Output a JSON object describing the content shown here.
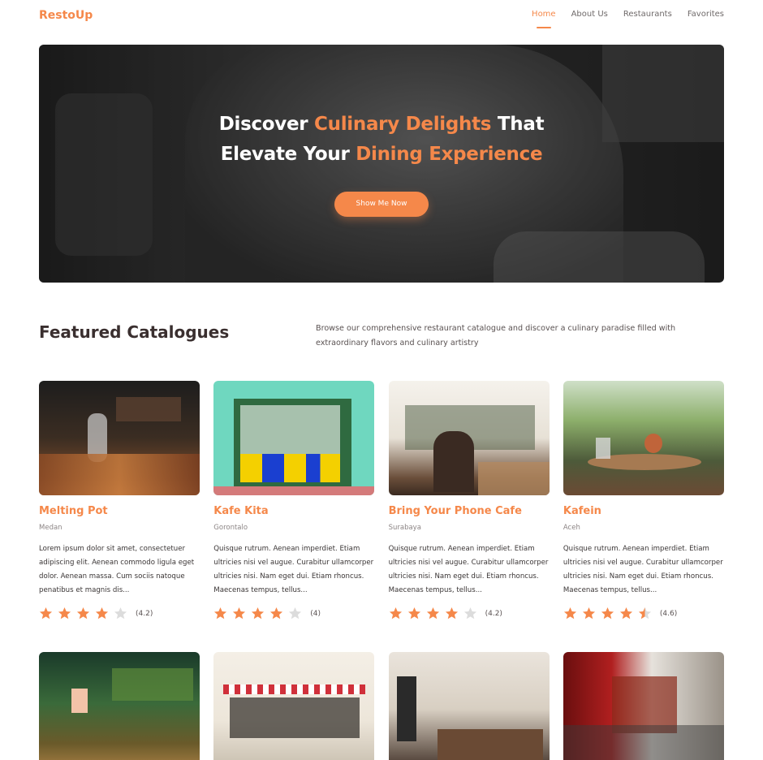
{
  "nav": {
    "brand": "RestoUp",
    "links": [
      "Home",
      "About Us",
      "Restaurants",
      "Favorites"
    ],
    "active": "Home"
  },
  "hero": {
    "line1_a": "Discover ",
    "line1_b": "Culinary Delights",
    "line1_c": " That",
    "line2_a": "Elevate Your ",
    "line2_b": "Dining Experience",
    "cta": "Show Me Now"
  },
  "section": {
    "title": "Featured Catalogues",
    "description": "Browse our comprehensive restaurant catalogue and discover a culinary paradise filled with extraordinary flavors and culinary artistry"
  },
  "restaurants": [
    {
      "name": "Melting Pot",
      "city": "Medan",
      "description": "Lorem ipsum dolor sit amet, consectetuer adipiscing elit. Aenean commodo ligula eget dolor. Aenean massa. Cum sociis natoque penatibus et magnis dis...",
      "rating": 4.2,
      "rating_label": "(4.2)"
    },
    {
      "name": "Kafe Kita",
      "city": "Gorontalo",
      "description": "Quisque rutrum. Aenean imperdiet. Etiam ultricies nisi vel augue. Curabitur ullamcorper ultricies nisi. Nam eget dui. Etiam rhoncus. Maecenas tempus, tellus...",
      "rating": 4,
      "rating_label": "(4)"
    },
    {
      "name": "Bring Your Phone Cafe",
      "city": "Surabaya",
      "description": "Quisque rutrum. Aenean imperdiet. Etiam ultricies nisi vel augue. Curabitur ullamcorper ultricies nisi. Nam eget dui. Etiam rhoncus. Maecenas tempus, tellus...",
      "rating": 4.2,
      "rating_label": "(4.2)"
    },
    {
      "name": "Kafein",
      "city": "Aceh",
      "description": "Quisque rutrum. Aenean imperdiet. Etiam ultricies nisi vel augue. Curabitur ullamcorper ultricies nisi. Nam eget dui. Etiam rhoncus. Maecenas tempus, tellus...",
      "rating": 4.6,
      "rating_label": "(4.6)"
    }
  ],
  "colors": {
    "accent": "#f5884a",
    "star_empty": "#dcdcdc"
  },
  "icons": {
    "star": "star-icon"
  }
}
